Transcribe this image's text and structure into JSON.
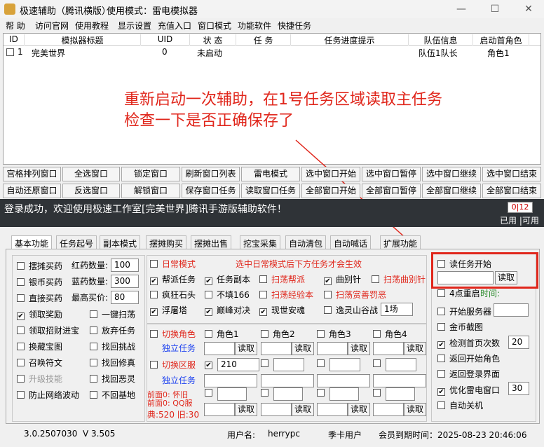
{
  "app": {
    "title": "极速辅助（腾讯横版）",
    "mode": "使用模式：雷电模拟器"
  },
  "window": {
    "min": "—",
    "max": "☐",
    "close": "✕"
  },
  "menu": [
    "帮 助",
    "访问官网",
    "使用教程",
    "显示设置",
    "充值入口",
    "窗口模式",
    "功能软件",
    "快捷任务"
  ],
  "list": {
    "headers": [
      "ID",
      "模拟器标题",
      "UID",
      "状 态",
      "任 务",
      "任务进度提示",
      "队伍信息",
      "启动首角色"
    ],
    "row": {
      "id": "1",
      "title": "完美世界",
      "uid": "0",
      "status": "未启动",
      "team": "队伍1队长",
      "role": "角色1"
    }
  },
  "annotation": [
    "重新启动一次辅助，在1号任务区域读取主任务",
    "检查一下是否正确保存了"
  ],
  "buttons": {
    "row1": [
      "宫格排列窗口",
      "全选窗口",
      "锁定窗口",
      "刷新窗口列表",
      "雷电模式",
      "选中窗口开始",
      "选中窗口暂停",
      "选中窗口继续",
      "选中窗口结束"
    ],
    "row2": [
      "自动还原窗口",
      "反选窗口",
      "解锁窗口",
      "保存窗口任务",
      "读取窗口任务",
      "全部窗口开始",
      "全部窗口暂停",
      "全部窗口继续",
      "全部窗口结束"
    ]
  },
  "status": {
    "msg": "登录成功，欢迎使用极速工作室[完美世界]腾讯手游版辅助软件！",
    "count": "0|12",
    "used": "已用 |可用"
  },
  "tabs": [
    "基本功能",
    "任务起号",
    "副本模式",
    "摆摊购买",
    "摆摊出售",
    "挖宝采集",
    "自动清包",
    "自动喊话",
    "扩展功能"
  ],
  "basic": {
    "left": [
      {
        "l": "摆摊买药",
        "on": false
      },
      {
        "l": "银币买药",
        "on": false
      },
      {
        "l": "直接买药",
        "on": false
      },
      {
        "l": "领取奖励",
        "on": true
      },
      {
        "l": "领取招财进宝",
        "on": false
      },
      {
        "l": "换藏宝图",
        "on": false
      },
      {
        "l": "召唤符文",
        "on": false
      },
      {
        "l": "升级技能",
        "on": false
      },
      {
        "l": "防止网络波动",
        "on": false
      }
    ],
    "fields": [
      {
        "l": "红药数量:",
        "v": "100"
      },
      {
        "l": "蓝药数量:",
        "v": "300"
      },
      {
        "l": "最高买价:",
        "v": "80"
      }
    ],
    "right": [
      {
        "l": "一键扫荡",
        "on": false
      },
      {
        "l": "放弃任务",
        "on": false
      },
      {
        "l": "找回挑战",
        "on": false
      },
      {
        "l": "找回修真",
        "on": false
      },
      {
        "l": "找回恶灵",
        "on": false
      },
      {
        "l": "不回基地",
        "on": false
      }
    ]
  },
  "daily": {
    "mode": "日常模式",
    "hint": "选中日常模式后下方任务才会生效",
    "r1": [
      {
        "l": "帮派任务",
        "on": true
      },
      {
        "l": "任务副本",
        "on": true
      },
      {
        "l": "扫荡帮派",
        "on": false,
        "c": "red"
      },
      {
        "l": "曲别针",
        "on": true
      },
      {
        "l": "扫荡曲别针",
        "on": false,
        "c": "red"
      }
    ],
    "r2": [
      {
        "l": "疯狂石头",
        "on": false
      },
      {
        "l": "不填166",
        "on": false
      },
      {
        "l": "扫荡经验本",
        "on": false,
        "c": "red"
      },
      {
        "l": "扫荡赏善罚恶",
        "on": false,
        "c": "red"
      }
    ],
    "r3": [
      {
        "l": "浮屠塔",
        "on": true
      },
      {
        "l": "巅峰对决",
        "on": true
      },
      {
        "l": "现世安魂",
        "on": true
      },
      {
        "l": "逸灵山谷战",
        "on": false
      }
    ],
    "select": "1场"
  },
  "roles": {
    "switch_role": "切换角色",
    "role_opts": [
      "角色1",
      "角色2",
      "角色3",
      "角色4"
    ],
    "task": "独立任务",
    "read": "读取",
    "switch_server": "切换区服",
    "server": "210",
    "task2": "独立任务",
    "front1": "前面0: 怀旧",
    "front2": "前面0: QQ服",
    "dian": "典:520 旧:30"
  },
  "ext": {
    "read_start": "读任务开始",
    "read": "读取",
    "retry": "4点重启",
    "time": "时间:",
    "server": "开始服务器",
    "gold": "金币截图",
    "check": "检测首页次数",
    "check_v": "20",
    "ret_role": "返回开始角色",
    "ret_login": "返回登录界面",
    "opt": "优化雷电窗口",
    "opt_v": "30",
    "shutdown": "自动关机"
  },
  "footer": {
    "ver": "3.0.2507030",
    "v": "V 3.505",
    "user_l": "用户名:",
    "user": "herrypc",
    "type": "季卡用户",
    "exp": "会员到期时间：2025-08-23 20:46:06"
  },
  "colors": {
    "accent_red": "#e0261b",
    "blue": "#1a3ff0"
  }
}
